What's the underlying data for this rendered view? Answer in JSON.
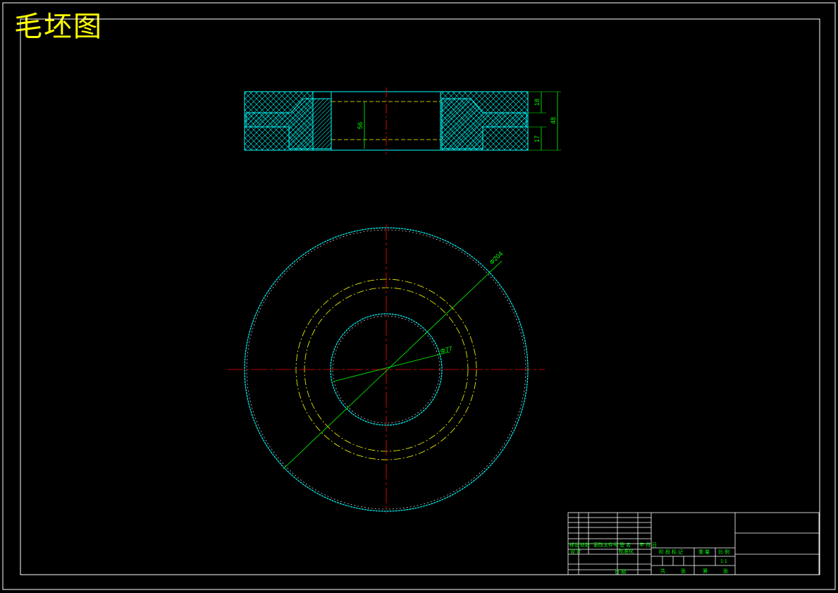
{
  "page_title": "毛坯图",
  "colors": {
    "frame": "#ffffff",
    "outline": "#00ffff",
    "dimension": "#00ff00",
    "centerline": "#ff0000",
    "hidden_circle": "#ffff00",
    "title": "#ffff00",
    "background": "#000000"
  },
  "section_view": {
    "dim_bore": "56",
    "dim_top": "18",
    "dim_total": "48",
    "dim_bottom": "17"
  },
  "plan_view": {
    "dim_outer_dia": "Φ204",
    "dim_inner_dia": "Φ77"
  },
  "title_block": {
    "rev_labels": [
      "标记",
      "处数",
      "更改文件号",
      "签 名",
      "年 月 日"
    ],
    "row_design": "设 计",
    "row_standard": "标准化",
    "row_date": "日 期",
    "stage_labels": [
      "阶 段 标 记",
      "重 量",
      "比 例"
    ],
    "scale": "1:1",
    "sheet_labels": [
      "共",
      "张",
      "第",
      "张"
    ]
  }
}
